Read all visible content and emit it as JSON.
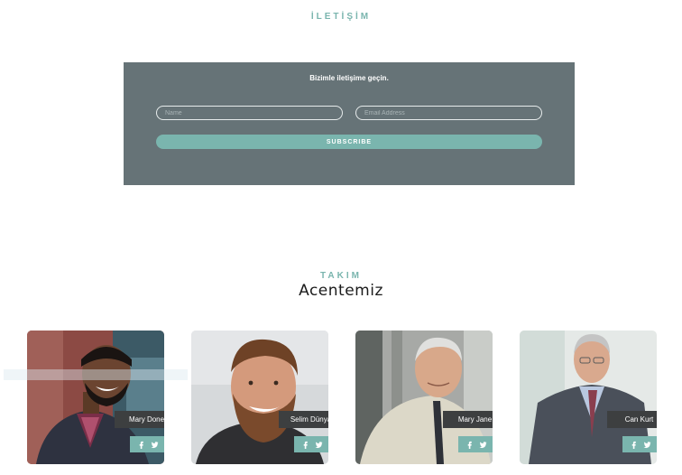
{
  "contact": {
    "section_label": "İLETİŞİM",
    "heading": "Bizimle iletişime geçin.",
    "name_placeholder": "Name",
    "email_placeholder": "Email Address",
    "subscribe_label": "SUBSCRIBE"
  },
  "team": {
    "section_label": "TAKIM",
    "title": "Acentemiz",
    "members": [
      {
        "name": "Mary Done"
      },
      {
        "name": "Selim Dünya"
      },
      {
        "name": "Mary Jane"
      },
      {
        "name": "Can Kurt"
      }
    ],
    "social_icons": [
      "facebook-icon",
      "twitter-icon",
      "google-plus-icon"
    ]
  },
  "colors": {
    "accent": "#7ab5ae",
    "contact_bg": "#667377",
    "name_tag_bg": "#3d3f40"
  }
}
